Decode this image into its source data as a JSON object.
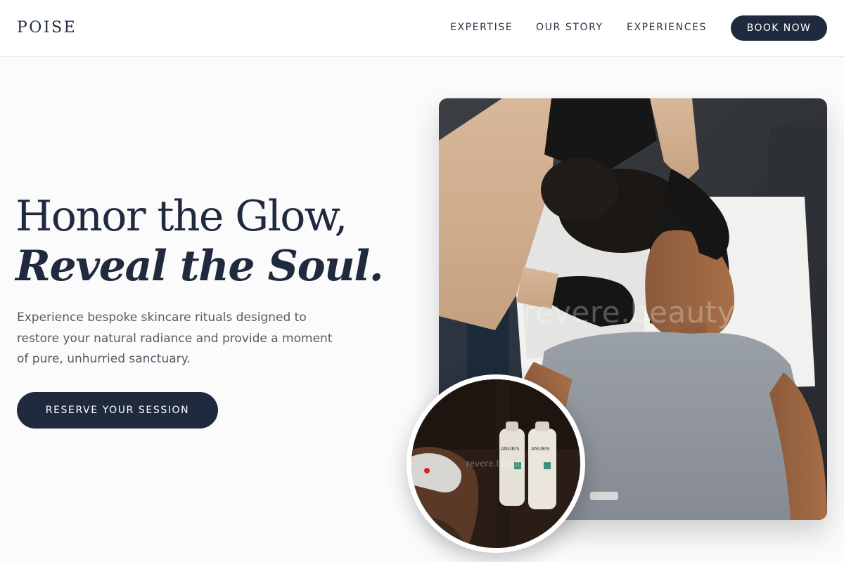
{
  "nav": {
    "logo": "POISE",
    "links": [
      "EXPERTISE",
      "OUR STORY",
      "EXPERIENCES"
    ],
    "cta": "BOOK NOW"
  },
  "hero": {
    "headline_line1": "Honor the Glow,",
    "headline_line2": "Reveal the Soul.",
    "subtext": "Experience bespoke skincare rituals designed to restore your natural radiance and provide a moment of pure, unhurried sanctuary.",
    "cta": "RESERVE YOUR SESSION"
  },
  "images": {
    "main_watermark": "revere.beauty",
    "inset_watermark": "revere.beauty",
    "bottle_brand": "ANUBIS"
  },
  "colors": {
    "navy": "#1f2a3e",
    "background": "#fbfbfb",
    "body_text": "#555b66"
  }
}
